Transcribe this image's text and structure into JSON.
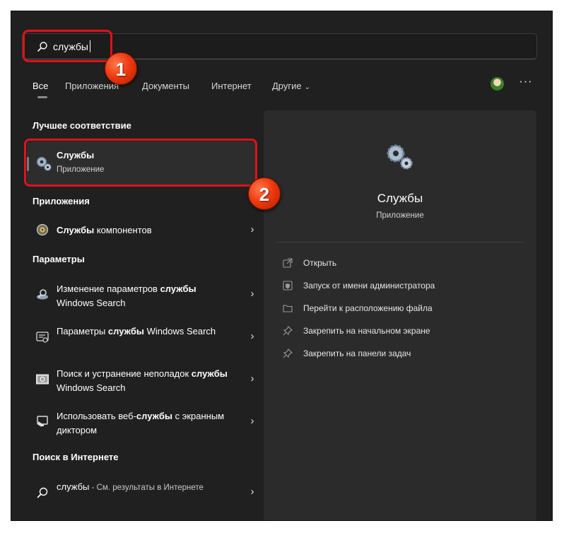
{
  "search": {
    "query": "службы"
  },
  "tabs": [
    {
      "label": "Все"
    },
    {
      "label": "Приложения"
    },
    {
      "label": "Документы"
    },
    {
      "label": "Интернет"
    },
    {
      "label": "Другие"
    }
  ],
  "more_label": "···",
  "best_match": {
    "section_title": "Лучшее соответствие",
    "title": "Службы",
    "subtitle": "Приложение"
  },
  "apps": {
    "section_title": "Приложения",
    "items": [
      {
        "bold": "Службы",
        "rest": " компонентов"
      }
    ]
  },
  "settings": {
    "section_title": "Параметры",
    "items": [
      {
        "pre": "Изменение параметров ",
        "bold": "службы",
        "post": " Windows Search"
      },
      {
        "pre": "Параметры ",
        "bold": "службы",
        "post": " Windows Search"
      },
      {
        "pre": "Поиск и устранение неполадок ",
        "bold": "службы",
        "post": " Windows Search"
      },
      {
        "pre": "Использовать веб-",
        "bold": "службы",
        "post": " с экранным диктором"
      }
    ]
  },
  "web": {
    "section_title": "Поиск в Интернете",
    "query": "службы",
    "suffix": " - См. результаты в Интернете"
  },
  "detail": {
    "title": "Службы",
    "subtitle": "Приложение",
    "actions": [
      {
        "label": "Открыть",
        "icon": "open-icon"
      },
      {
        "label": "Запуск от имени администратора",
        "icon": "admin-shield-icon"
      },
      {
        "label": "Перейти к расположению файла",
        "icon": "folder-icon"
      },
      {
        "label": "Закрепить на начальном экране",
        "icon": "pin-icon"
      },
      {
        "label": "Закрепить на панели задач",
        "icon": "pin-icon"
      }
    ]
  },
  "annotations": {
    "step1": "1",
    "step2": "2"
  },
  "colors": {
    "panel": "#202020",
    "detail_pane": "#2b2b2b",
    "highlight": "#e0121a",
    "badge": "#f03a10"
  }
}
